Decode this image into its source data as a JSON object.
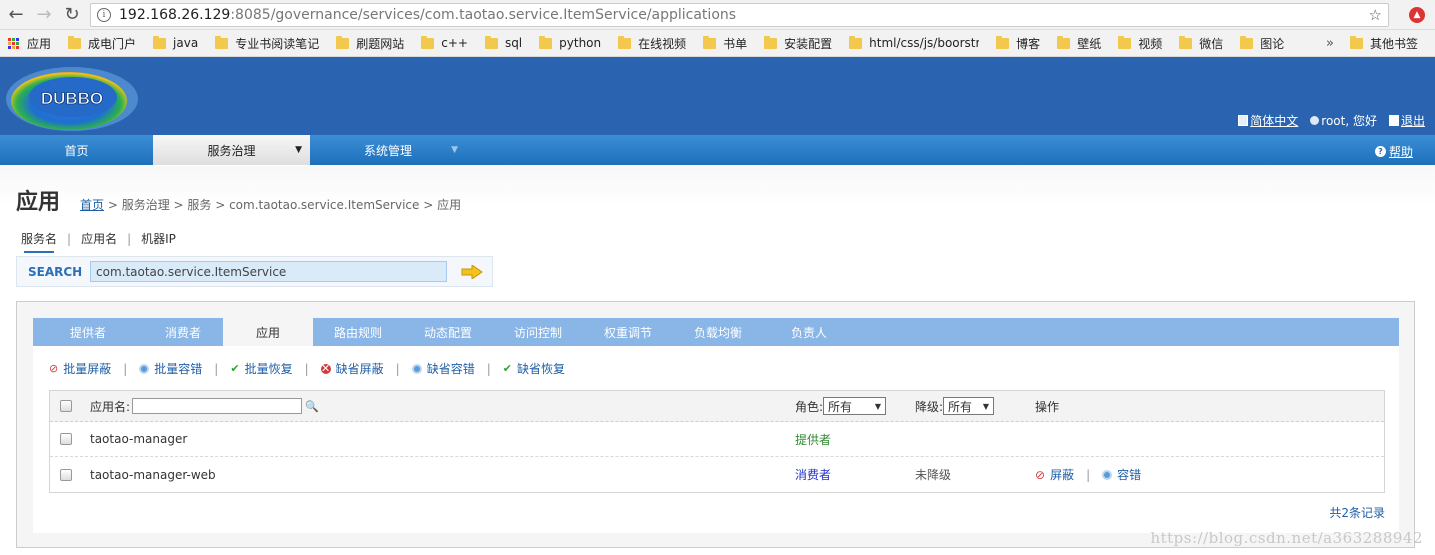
{
  "browser": {
    "url_host": "192.168.26.129",
    "url_path": ":8085/governance/services/com.taotao.service.ItemService/applications",
    "bookmarks": [
      "应用",
      "成电门户",
      "java",
      "专业书阅读笔记",
      "刷题网站",
      "c++",
      "sql",
      "python",
      "在线视频",
      "书单",
      "安装配置",
      "html/css/js/boorstra",
      "博客",
      "壁纸",
      "视频",
      "微信",
      "图论"
    ],
    "more_label": "»",
    "other_bookmarks": "其他书签"
  },
  "header": {
    "logo_text": "DUBBO",
    "lang": "简体中文",
    "user": "root, 您好",
    "logout": "退出"
  },
  "menu": {
    "items": [
      {
        "label": "首页"
      },
      {
        "label": "服务治理"
      },
      {
        "label": "系统管理"
      }
    ],
    "help": "帮助"
  },
  "page": {
    "title": "应用",
    "breadcrumb_home": "首页",
    "breadcrumb_rest": " > 服务治理 > 服务 > com.taotao.service.ItemService > 应用"
  },
  "search": {
    "tabs": [
      "服务名",
      "应用名",
      "机器IP"
    ],
    "label": "SEARCH",
    "value": "com.taotao.service.ItemService"
  },
  "tabs": [
    "提供者",
    "消费者",
    "应用",
    "路由规则",
    "动态配置",
    "访问控制",
    "权重调节",
    "负载均衡",
    "负责人"
  ],
  "actions": [
    "批量屏蔽",
    "批量容错",
    "批量恢复",
    "缺省屏蔽",
    "缺省容错",
    "缺省恢复"
  ],
  "grid": {
    "app_name_label": "应用名:",
    "role_label": "角色:",
    "role_value": "所有",
    "degrade_label": "降级:",
    "degrade_value": "所有",
    "ops_label": "操作",
    "rows": [
      {
        "name": "taotao-manager",
        "role": "提供者",
        "degrade": "",
        "op1": "",
        "op2": ""
      },
      {
        "name": "taotao-manager-web",
        "role": "消费者",
        "degrade": "未降级",
        "op1": "屏蔽",
        "op2": "容错"
      }
    ],
    "total": "共2条记录"
  },
  "watermark": "https://blog.csdn.net/a363288942"
}
